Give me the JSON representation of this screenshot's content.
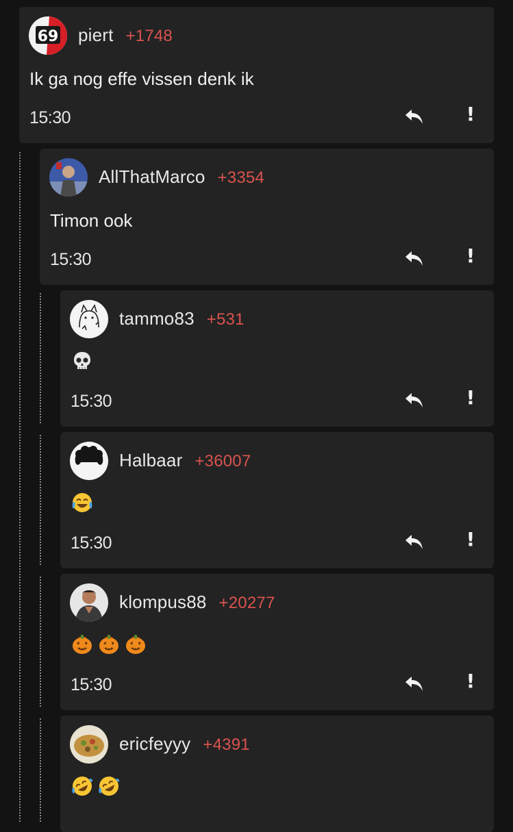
{
  "comments": [
    {
      "username": "piert",
      "score": "+1748",
      "body": "Ik ga nog effe vissen denk ik",
      "time": "15:30",
      "avatar": "avatar-69-icon"
    },
    {
      "username": "AllThatMarco",
      "score": "+3354",
      "body": "Timon ook",
      "time": "15:30",
      "avatar": "avatar-photo-icon"
    },
    {
      "username": "tammo83",
      "score": "+531",
      "emoji": [
        "skull"
      ],
      "time": "15:30",
      "avatar": "avatar-cat-icon"
    },
    {
      "username": "Halbaar",
      "score": "+36007",
      "emoji": [
        "tears-of-joy"
      ],
      "time": "15:30",
      "avatar": "avatar-hair-icon"
    },
    {
      "username": "klompus88",
      "score": "+20277",
      "emoji": [
        "jack-o-lantern",
        "jack-o-lantern",
        "jack-o-lantern"
      ],
      "time": "15:30",
      "avatar": "avatar-man-icon"
    },
    {
      "username": "ericfeyyy",
      "score": "+4391",
      "emoji": [
        "rolling-laughing",
        "rolling-laughing"
      ],
      "avatar": "avatar-food-icon"
    }
  ],
  "colors": {
    "background": "#131313",
    "card": "#232323",
    "score": "#d9534f",
    "text": "#e8e8e8"
  }
}
